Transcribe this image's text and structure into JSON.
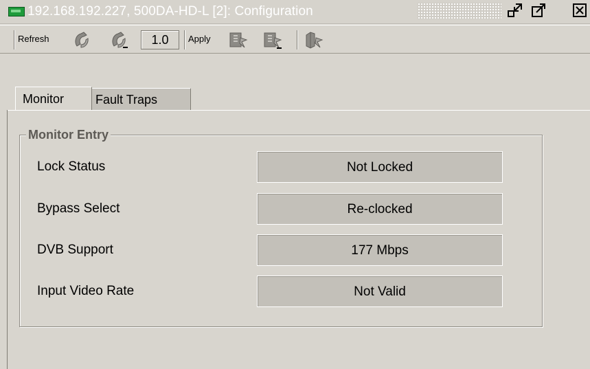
{
  "title": {
    "text": "192.168.192.227, 500DA-HD-L  [2]: Configuration",
    "icon": "device-card-icon",
    "buttons": [
      "minimize-icon",
      "detach-icon",
      "close-icon"
    ]
  },
  "toolbar": {
    "refresh_label": "Refresh",
    "version": "1.0",
    "apply_label": "Apply"
  },
  "tabs": [
    {
      "label": "Monitor",
      "active": true
    },
    {
      "label": "Fault Traps",
      "active": false
    }
  ],
  "group": {
    "title": "Monitor Entry",
    "rows": [
      {
        "label": "Lock Status",
        "value": "Not Locked"
      },
      {
        "label": "Bypass Select",
        "value": "Re-clocked"
      },
      {
        "label": "DVB Support",
        "value": "177 Mbps"
      },
      {
        "label": "Input Video Rate",
        "value": "Not Valid"
      }
    ]
  },
  "colors": {
    "title_text": "#ffffff",
    "group_title": "#5d5a55",
    "value_box": "#c3c0b9",
    "window_bg": "#d8d5ce"
  }
}
